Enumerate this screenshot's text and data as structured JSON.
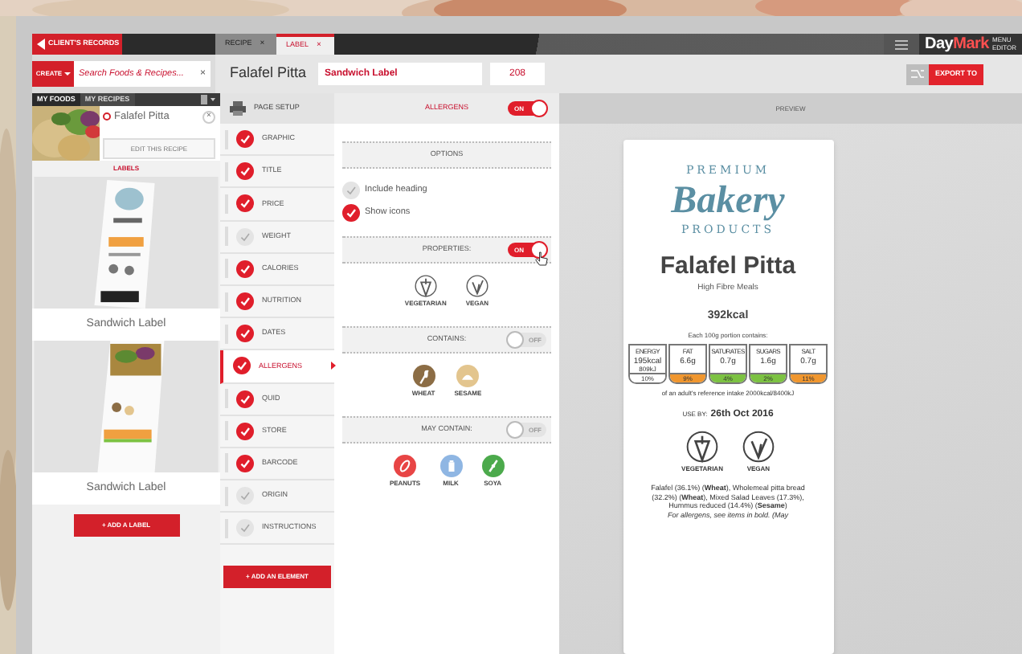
{
  "topbar": {
    "back_button": "CLIENT'S RECORDS",
    "tabs": [
      {
        "label": "RECIPE",
        "close": "×",
        "selected": false
      },
      {
        "label": "LABEL",
        "close": "×",
        "selected": true
      }
    ],
    "brand": {
      "part_a": "Day",
      "part_b": "Mark",
      "subtitle": "MENU EDITOR"
    }
  },
  "toolbar": {
    "create_button": "CREATE",
    "search": {
      "placeholder": "Search Foods & Recipes...",
      "clear": "×"
    },
    "recipe_title": "Falafel Pitta",
    "label_name": "Sandwich Label",
    "label_code": "208",
    "export_button": "EXPORT TO"
  },
  "sidebar": {
    "tabs": [
      {
        "label": "MY FOODS",
        "selected": true
      },
      {
        "label": "MY RECIPES",
        "selected": false
      }
    ],
    "recipe": {
      "name": "Falafel Pitta",
      "selected": true,
      "close": "×",
      "edit_button": "EDIT THIS RECIPE"
    },
    "labels_heading": "LABELS",
    "labels": [
      {
        "name": "Sandwich Label"
      },
      {
        "name": "Sandwich Label"
      }
    ],
    "add_label_button": "+ ADD A LABEL"
  },
  "elements": {
    "page_setup": "PAGE SETUP",
    "items": [
      {
        "label": "GRAPHIC",
        "checked": true,
        "selected": false
      },
      {
        "label": "TITLE",
        "checked": true,
        "selected": false
      },
      {
        "label": "PRICE",
        "checked": true,
        "selected": false
      },
      {
        "label": "WEIGHT",
        "checked": false,
        "selected": false
      },
      {
        "label": "CALORIES",
        "checked": true,
        "selected": false
      },
      {
        "label": "NUTRITION",
        "checked": true,
        "selected": false
      },
      {
        "label": "DATES",
        "checked": true,
        "selected": false
      },
      {
        "label": "ALLERGENS",
        "checked": true,
        "selected": true
      },
      {
        "label": "QUID",
        "checked": true,
        "selected": false
      },
      {
        "label": "STORE",
        "checked": true,
        "selected": false
      },
      {
        "label": "BARCODE",
        "checked": true,
        "selected": false
      },
      {
        "label": "ORIGIN",
        "checked": false,
        "selected": false
      },
      {
        "label": "INSTRUCTIONS",
        "checked": false,
        "selected": false
      }
    ],
    "add_button": "+ ADD AN ELEMENT"
  },
  "options": {
    "title": "ALLERGENS",
    "on": true,
    "toggle_text": "ON",
    "options_heading": "OPTIONS",
    "checkboxes": [
      {
        "label": "Include heading",
        "checked": false
      },
      {
        "label": "Show icons",
        "checked": true
      }
    ],
    "sections": [
      {
        "title": "PROPERTIES:",
        "on": true,
        "toggle_text": "ON",
        "cursor": true,
        "icons": [
          {
            "label": "VEGETARIAN",
            "kind": "vegetarian",
            "color": "#5a5a5a"
          },
          {
            "label": "VEGAN",
            "kind": "vegan",
            "color": "#5a5a5a"
          }
        ]
      },
      {
        "title": "CONTAINS:",
        "on": false,
        "toggle_text": "OFF",
        "cursor": false,
        "icons": [
          {
            "label": "WHEAT",
            "kind": "wheat",
            "color": "#8c6d45"
          },
          {
            "label": "SESAME",
            "kind": "sesame",
            "color": "#e3c58e"
          }
        ]
      },
      {
        "title": "MAY CONTAIN:",
        "on": false,
        "toggle_text": "OFF",
        "cursor": false,
        "icons": [
          {
            "label": "PEANUTS",
            "kind": "peanut",
            "color": "#e84545"
          },
          {
            "label": "MILK",
            "kind": "milk",
            "color": "#8fb6e3"
          },
          {
            "label": "SOYA",
            "kind": "soya",
            "color": "#4caa4c"
          }
        ]
      }
    ]
  },
  "preview": {
    "heading": "PREVIEW",
    "logo": {
      "top": "PREMIUM",
      "main": "Bakery",
      "bottom": "PRODUCTS"
    },
    "title": "Falafel Pitta",
    "subtitle": "High Fibre Meals",
    "calories": "392kcal",
    "portion_note": "Each 100g portion contains:",
    "nutrition": [
      {
        "name": "ENERGY",
        "value": "195kcal",
        "value_2": "809kJ",
        "percent": "10%",
        "color": "#ffffff"
      },
      {
        "name": "FAT",
        "value": "6.6g",
        "percent": "9%",
        "color": "#f0962e"
      },
      {
        "name": "SATURATES",
        "value": "0.7g",
        "percent": "4%",
        "color": "#7cc242"
      },
      {
        "name": "SUGARS",
        "value": "1.6g",
        "percent": "2%",
        "color": "#7cc242"
      },
      {
        "name": "SALT",
        "value": "0.7g",
        "percent": "11%",
        "color": "#f0962e"
      }
    ],
    "reference_note": "of an adult's reference intake 2000kcal/8400kJ",
    "use_by_label": "USE BY:",
    "use_by_date": "26th Oct 2016",
    "diet_icons": [
      {
        "label": "VEGETARIAN",
        "kind": "vegetarian"
      },
      {
        "label": "VEGAN",
        "kind": "vegan"
      }
    ],
    "ingredients": "Falafel (36.1%) (**Wheat**), Wholemeal pitta bread (32.2%) (**Wheat**), Mixed Salad Leaves (17.3%), Hummus reduced (14.4%) (**Sesame**)",
    "allergen_note": "For allergens, see items in bold. (May"
  }
}
